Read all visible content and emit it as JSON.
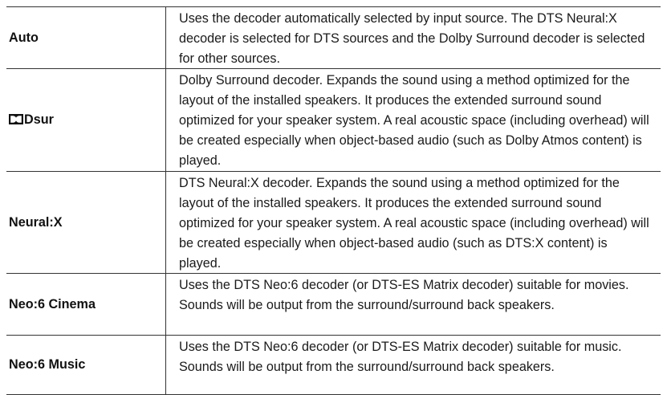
{
  "rows": [
    {
      "label": "Auto",
      "description": "Uses the decoder automatically selected by input source. The DTS Neural:X decoder is selected for DTS sources and the Dolby Surround decoder is selected for other sources."
    },
    {
      "label": "Dsur",
      "logo": "dolby-double-d-icon",
      "description": "Dolby Surround decoder. Expands the sound using a method optimized for the layout of the installed speakers. It produces the extended surround sound optimized for your speaker system. A real acoustic space (including overhead) will be created especially when object-based audio (such as Dolby Atmos content) is played."
    },
    {
      "label": "Neural:X",
      "description": "DTS Neural:X decoder. Expands the sound using a method optimized for the layout of the installed speakers. It produces the extended surround sound optimized for your speaker system. A real acoustic space (including overhead) will be created especially when object-based audio (such as DTS:X content) is played."
    },
    {
      "label": "Neo:6 Cinema",
      "description": "Uses the DTS Neo:6 decoder (or DTS-ES Matrix decoder) suitable for movies. Sounds will be output from the surround/surround back speakers."
    },
    {
      "label": "Neo:6 Music",
      "description": "Uses the DTS Neo:6 decoder (or DTS-ES Matrix decoder) suitable for music. Sounds will be output from the surround/surround back speakers."
    }
  ]
}
